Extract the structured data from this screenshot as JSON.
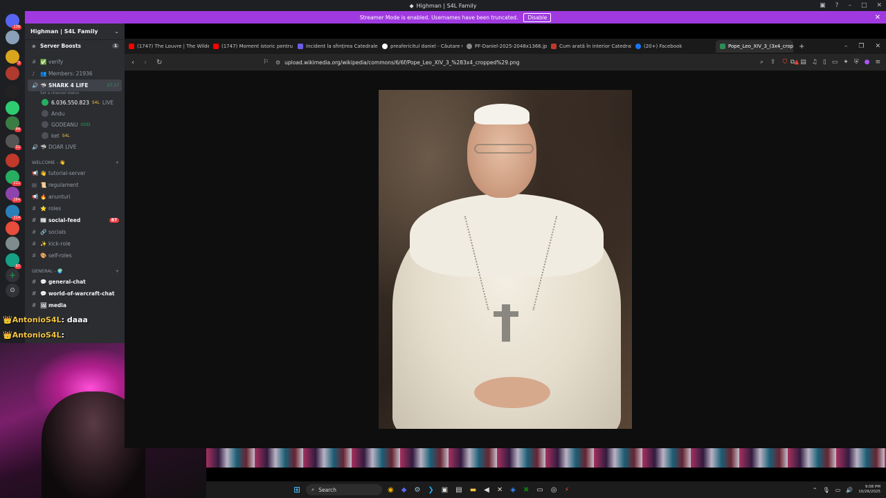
{
  "window": {
    "title": "Highman | S4L Family"
  },
  "banner": {
    "text": "Streamer Mode is enabled. Usernames have been truncated.",
    "button": "Disable"
  },
  "server": {
    "name": "Highman | S4L Family",
    "boosts": "Server Boosts",
    "boosts_count": "1",
    "channels": [
      {
        "name": "verify",
        "emoji": "✅"
      },
      {
        "name": "Members: 21936",
        "emoji": "👥"
      }
    ],
    "voice": {
      "name": "SHARK 4 LIFE",
      "timer": "27:17",
      "status": "Set a channel status",
      "users": [
        {
          "name": "6.036.550.823",
          "tag": "S4L",
          "live": "LIVE"
        },
        {
          "name": "Andu",
          "tag": ""
        },
        {
          "name": "GODEANU",
          "tag": "GOD"
        },
        {
          "name": "ket",
          "tag": "S4L"
        }
      ]
    },
    "doar_live": "DOAR LIVE",
    "welcome_category": "WELCOME - 👋",
    "welcome_channels": [
      {
        "name": "tutorial-server",
        "emoji": "👋"
      },
      {
        "name": "regulament",
        "emoji": "📜"
      },
      {
        "name": "anunturi",
        "emoji": "🔥"
      },
      {
        "name": "roles",
        "emoji": "⭐"
      },
      {
        "name": "social-feed",
        "emoji": "📰",
        "count": "87"
      },
      {
        "name": "socials",
        "emoji": "🔗"
      },
      {
        "name": "kick-role",
        "emoji": "✨"
      },
      {
        "name": "self-roles",
        "emoji": "🎨"
      }
    ],
    "general_category": "GENERAL - 🌍",
    "general_channels": [
      {
        "name": "general-chat",
        "emoji": "💬"
      },
      {
        "name": "world-of-warcraft-chat",
        "emoji": "💬"
      },
      {
        "name": "media",
        "emoji": "🖼"
      }
    ]
  },
  "overlay": [
    {
      "user": "AntonioS4L",
      "msg": ": daaa"
    },
    {
      "user": "AntonioS4L",
      "msg": ":"
    }
  ],
  "rail_badges": [
    "138",
    "3",
    "44",
    "22",
    "211",
    "264",
    "214",
    "87"
  ],
  "browser": {
    "tabs": [
      {
        "label": "(1747) The Louvre | The Wilder",
        "color": "#ff0000"
      },
      {
        "label": "(1747) Moment istoric pentru",
        "color": "#ff0000"
      },
      {
        "label": "Incident la sfințirea Catedralei",
        "color": "#6c5ce7"
      },
      {
        "label": "preafericitul daniel - Căutare G",
        "color": "#ffffff"
      },
      {
        "label": "PF-Daniel-2025-2048x1366.jpg",
        "color": "#888888"
      },
      {
        "label": "Cum arată în interior Catedrala",
        "color": "#c0392b"
      },
      {
        "label": "(20+) Facebook",
        "color": "#1877f2"
      },
      {
        "label": "Pope_Leo_XIV_3_(3x4_crop",
        "color": "#2e8b57"
      }
    ],
    "new_tab": "+",
    "url": "upload.wikimedia.org/wikipedia/commons/6/6f/Pope_Leo_XIV_3_%283x4_cropped%29.png"
  },
  "taskbar": {
    "search": "Search",
    "time": "9:08 PM",
    "date": "10/26/2025"
  }
}
